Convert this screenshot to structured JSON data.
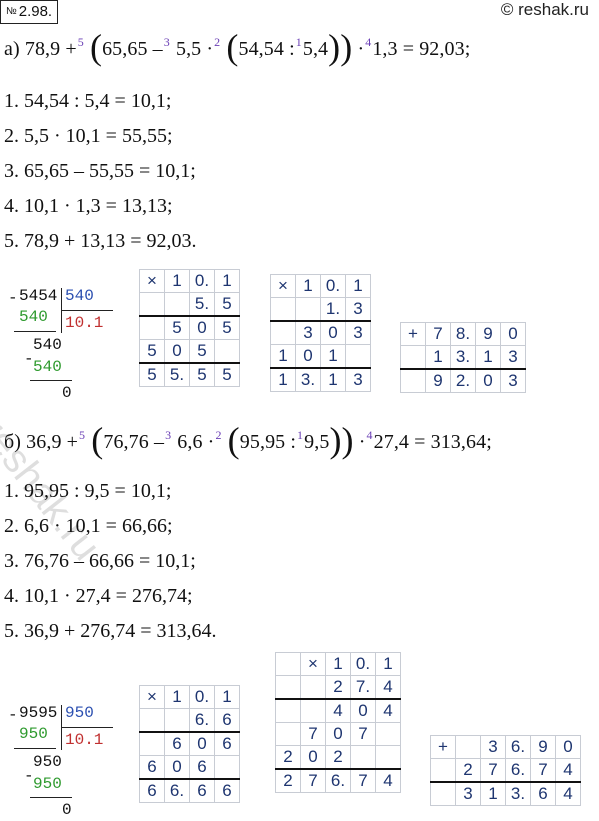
{
  "header": {
    "number_prefix": "№",
    "number": "2.98.",
    "site": "© reshak.ru"
  },
  "part_a": {
    "label": "а)",
    "lead": "78,9 +",
    "o5": "5",
    "t1": "65,65 –",
    "o3": "3",
    "t2": "5,5 ·",
    "o2": "2",
    "t3": "54,54 :",
    "o1": "1",
    "t4": "5,4",
    "o4": "4",
    "t5": "1,3 = 92,03;",
    "steps": [
      "1.  54,54 : 5,4 = 10,1;",
      "2.  5,5 · 10,1 = 55,55;",
      "3.  65,65 – 55,55 = 10,1;",
      "4.  10,1 · 1,3 = 13,13;",
      "5.  78,9 + 13,13 = 92,03."
    ],
    "division": {
      "dividend": "5454",
      "divisor": "540",
      "sub1": "540",
      "quotient": "10.1",
      "rem1": "540",
      "sub2": "540",
      "rest": "0"
    }
  },
  "part_b": {
    "label": "б)",
    "lead": "36,9 +",
    "o5": "5",
    "t1": "76,76 –",
    "o3": "3",
    "t2": "6,6 ·",
    "o2": "2",
    "t3": "95,95 :",
    "o1": "1",
    "t4": "9,5",
    "o4": "4",
    "t5": "27,4 = 313,64;",
    "steps": [
      "1.  95,95 : 9,5 = 10,1;",
      "2.  6,6 · 10,1 = 66,66;",
      "3.  76,76 – 66,66 = 10,1;",
      "4.  10,1 · 27,4 = 276,74;",
      "5.  36,9 + 276,74 = 313,64."
    ],
    "division": {
      "dividend": "9595",
      "divisor": "950",
      "sub1": "950",
      "quotient": "10.1",
      "rem1": "950",
      "sub2": "950",
      "rest": "0"
    }
  },
  "grids": {
    "a_mul1": [
      [
        "×",
        "1",
        "0.",
        "1"
      ],
      [
        "",
        "",
        "5.",
        "5"
      ],
      [
        "",
        "5",
        "0",
        "5"
      ],
      [
        "5",
        "0",
        "5",
        ""
      ],
      [
        "5",
        "5.",
        "5",
        "5"
      ]
    ],
    "a_mul2": [
      [
        "×",
        "1",
        "0.",
        "1"
      ],
      [
        "",
        "",
        "1.",
        "3"
      ],
      [
        "",
        "3",
        "0",
        "3"
      ],
      [
        "1",
        "0",
        "1",
        ""
      ],
      [
        "1",
        "3.",
        "1",
        "3"
      ]
    ],
    "a_add": [
      [
        "+",
        "7",
        "8.",
        "9",
        "0"
      ],
      [
        "",
        "1",
        "3.",
        "1",
        "3"
      ],
      [
        "",
        "9",
        "2.",
        "0",
        "3"
      ]
    ],
    "b_mul1": [
      [
        "×",
        "1",
        "0.",
        "1"
      ],
      [
        "",
        "",
        "6.",
        "6"
      ],
      [
        "",
        "6",
        "0",
        "6"
      ],
      [
        "6",
        "0",
        "6",
        ""
      ],
      [
        "6",
        "6.",
        "6",
        "6"
      ]
    ],
    "b_mul2": [
      [
        "",
        "×",
        "1",
        "0.",
        "1"
      ],
      [
        "",
        "",
        "2",
        "7.",
        "4"
      ],
      [
        "",
        "",
        "4",
        "0",
        "4"
      ],
      [
        "",
        "7",
        "0",
        "7",
        ""
      ],
      [
        "2",
        "0",
        "2",
        "",
        ""
      ],
      [
        "2",
        "7",
        "6.",
        "7",
        "4"
      ]
    ],
    "b_add": [
      [
        "+",
        "",
        "3",
        "6.",
        "9",
        "0"
      ],
      [
        "",
        "2",
        "7",
        "6.",
        "7",
        "4"
      ],
      [
        "",
        "3",
        "1",
        "3.",
        "6",
        "4"
      ]
    ]
  },
  "watermark": "reshak.ru"
}
